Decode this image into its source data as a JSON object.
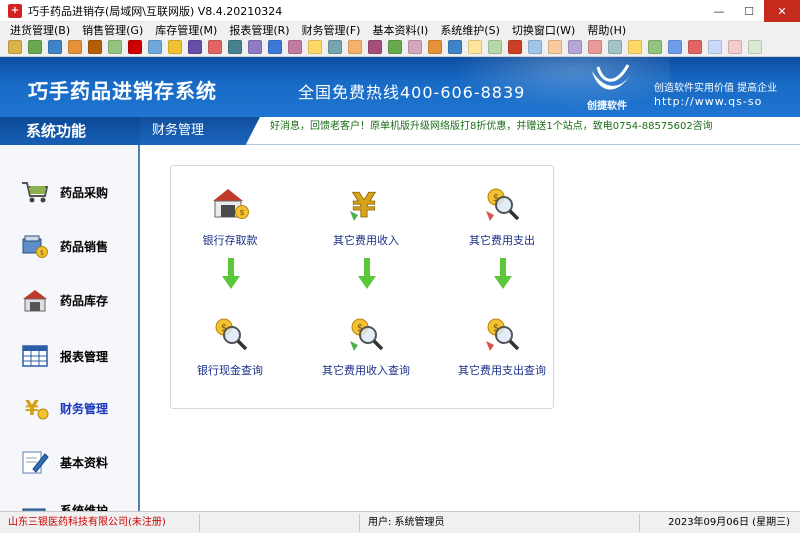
{
  "window": {
    "title": "巧手药品进销存(局域网\\互联网版) V8.4.20210324",
    "minimize": "—",
    "maximize": "☐",
    "close": "✕"
  },
  "menu": [
    "进货管理(B)",
    "销售管理(G)",
    "库存管理(M)",
    "报表管理(R)",
    "财务管理(F)",
    "基本资料(I)",
    "系统维护(S)",
    "切换窗口(W)",
    "帮助(H)"
  ],
  "toolbar": {
    "button_colors": [
      "#d9b24a",
      "#6aa84f",
      "#3d85c6",
      "#e69138",
      "#b45f06",
      "#93c47d",
      "#cc0000",
      "#6fa8dc",
      "#f1c232",
      "#674ea7",
      "#e06666",
      "#45818e",
      "#8e7cc3",
      "#3c78d8",
      "#c27ba0",
      "#ffd966",
      "#76a5af",
      "#f6b26b",
      "#a64d79",
      "#6aa84f",
      "#d5a6bd",
      "#e69138",
      "#3d85c6",
      "#ffe599",
      "#b6d7a8",
      "#cc4125",
      "#9fc5e8",
      "#f9cb9c",
      "#b4a7d6",
      "#ea9999",
      "#a2c4c9",
      "#ffd966",
      "#93c47d",
      "#6d9eeb",
      "#e06666",
      "#c9daf8",
      "#f4cccc",
      "#d9ead3"
    ]
  },
  "banner": {
    "title": "巧手药品进销存系统",
    "hotline": "全国免费热线400-606-8839",
    "brand": "创捷软件",
    "slogan": "创造软件实用价值   提高企业",
    "url": "http://www.qs-so"
  },
  "strip": {
    "section": "系统功能",
    "current": "财务管理",
    "notice": "好消息，回馈老客户！原单机版升级网络版打8折优惠，并赠送1个站点，致电0754-88575602咨询"
  },
  "sidebar": [
    {
      "label": "药品采购",
      "icon": "cart-icon"
    },
    {
      "label": "药品销售",
      "icon": "sales-icon"
    },
    {
      "label": "药品库存",
      "icon": "warehouse-icon"
    },
    {
      "label": "报表管理",
      "icon": "report-table-icon"
    },
    {
      "label": "财务管理",
      "icon": "finance-yen-icon"
    },
    {
      "label": "基本资料",
      "icon": "edit-pencil-icon"
    },
    {
      "label": "系统维护",
      "icon": "system-icon"
    }
  ],
  "functions": {
    "bank_deposit": "银行存取款",
    "other_income": "其它费用收入",
    "other_expense": "其它费用支出",
    "bank_cash_query": "银行现金查询",
    "other_income_query": "其它费用收入查询",
    "other_expense_query": "其它费用支出查询"
  },
  "status": {
    "company": "山东三银医药科技有限公司(未注册)",
    "blank": "",
    "user": "用户: 系统管理员",
    "date": "2023年09月06日 (星期三)"
  },
  "colors": {
    "banner_blue": "#1769c4",
    "arrow_green": "#5ac83a",
    "label_blue": "#1a2f8a",
    "company_red": "#cc0000"
  }
}
